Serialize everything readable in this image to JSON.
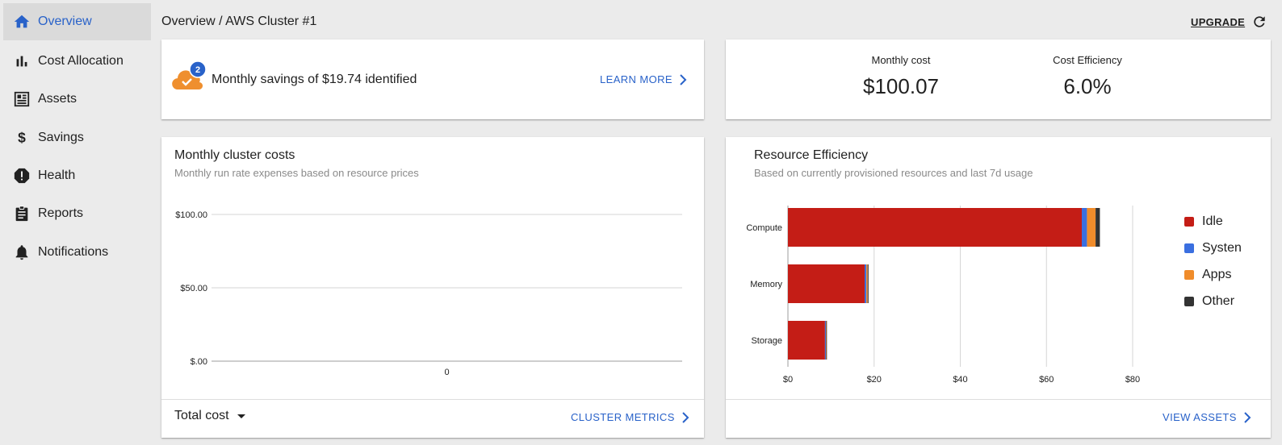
{
  "sidebar": {
    "items": [
      {
        "label": "Overview",
        "icon": "home-icon",
        "active": true
      },
      {
        "label": "Cost Allocation",
        "icon": "bar-chart-icon"
      },
      {
        "label": "Assets",
        "icon": "assets-icon"
      },
      {
        "label": "Savings",
        "icon": "dollar-icon"
      },
      {
        "label": "Health",
        "icon": "alert-icon"
      },
      {
        "label": "Reports",
        "icon": "clipboard-icon"
      },
      {
        "label": "Notifications",
        "icon": "bell-icon"
      }
    ]
  },
  "header": {
    "breadcrumb": "Overview / AWS Cluster #1",
    "upgrade_label": "UPGRADE"
  },
  "savings": {
    "badge_count": "2",
    "message": "Monthly savings of $19.74 identified",
    "link_label": "LEARN MORE"
  },
  "kpis": {
    "monthly_cost_label": "Monthly cost",
    "monthly_cost_value": "$100.07",
    "efficiency_label": "Cost Efficiency",
    "efficiency_value": "6.0%"
  },
  "costs_card": {
    "title": "Monthly cluster costs",
    "subtitle": "Monthly run rate expenses based on resource prices",
    "selector_label": "Total cost",
    "link_label": "CLUSTER METRICS"
  },
  "efficiency_card": {
    "title": "Resource Efficiency",
    "subtitle": "Based on currently provisioned resources and last 7d usage",
    "link_label": "VIEW ASSETS"
  },
  "colors": {
    "accent": "#2962c9",
    "idle": "#c41d16",
    "system": "#3a6fe0",
    "apps": "#f08c2b",
    "other": "#333333",
    "savings_cloud": "#ef8f2e"
  },
  "chart_data": [
    {
      "type": "line",
      "title": "Monthly cluster costs",
      "x_ticks": [
        "0"
      ],
      "y_ticks": [
        "$100.00",
        "$50.00",
        "$.00"
      ],
      "ylim": [
        0,
        100
      ],
      "series": [],
      "grid": true
    },
    {
      "type": "bar",
      "orientation": "horizontal",
      "stacked": true,
      "title": "Resource Efficiency",
      "categories": [
        "Compute",
        "Memory",
        "Storage"
      ],
      "series": [
        {
          "name": "Idle",
          "values": [
            68.2,
            17.8,
            8.6
          ]
        },
        {
          "name": "Systen",
          "values": [
            1.2,
            0.4,
            0.2
          ]
        },
        {
          "name": "Apps",
          "values": [
            2.0,
            0.3,
            0.1
          ]
        },
        {
          "name": "Other",
          "values": [
            1.0,
            0.2,
            0.1
          ]
        }
      ],
      "x_ticks": [
        "$0",
        "$20",
        "$40",
        "$60",
        "$80"
      ],
      "xlim": [
        0,
        80
      ],
      "legend": "right",
      "grid": true
    }
  ]
}
